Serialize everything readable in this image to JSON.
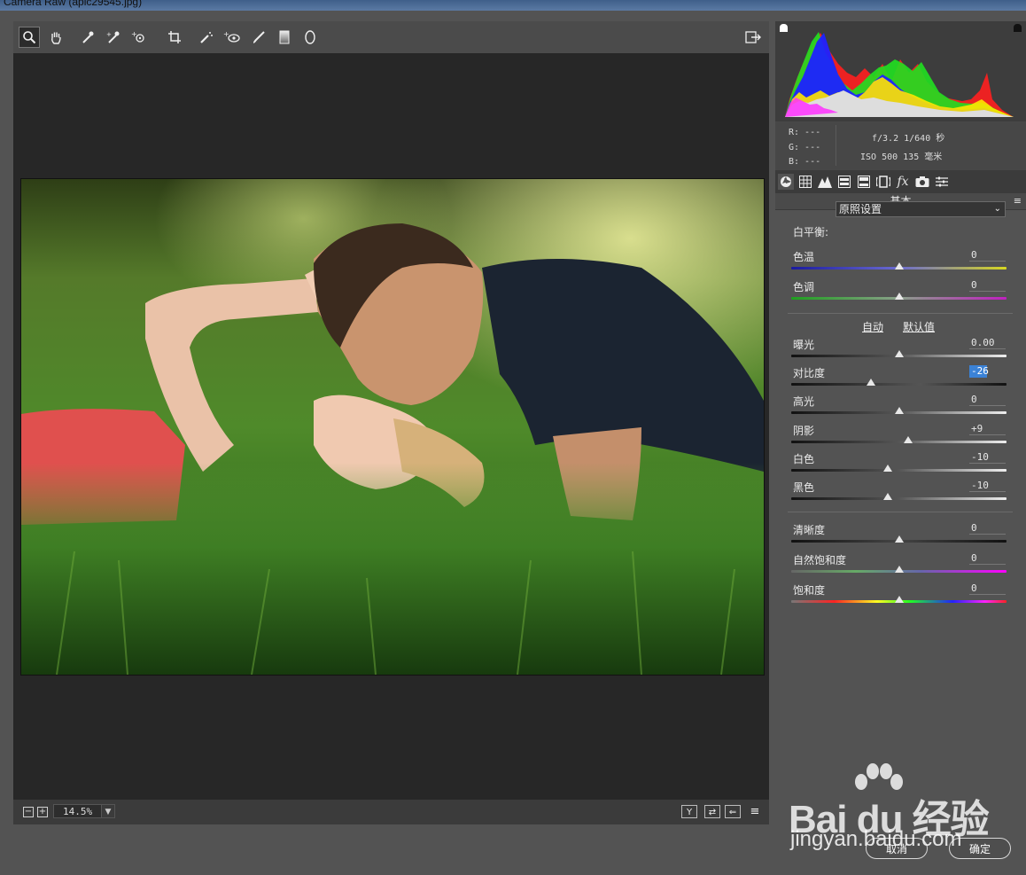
{
  "window": {
    "title": "Camera Raw (apic29545.jpg)"
  },
  "toolbar": {
    "tools": [
      {
        "icon": "zoom-icon",
        "glyph": "🔍",
        "active": true
      },
      {
        "icon": "hand-icon",
        "glyph": "✋"
      },
      {
        "icon": "white-balance-icon",
        "glyph": "✎"
      },
      {
        "icon": "color-sampler-icon",
        "glyph": "✑"
      },
      {
        "icon": "targeted-adjustment-icon",
        "glyph": "⊙"
      },
      {
        "icon": "crop-icon",
        "glyph": "⌗"
      },
      {
        "icon": "spot-removal-icon",
        "glyph": "✐"
      },
      {
        "icon": "red-eye-icon",
        "glyph": "+◎"
      },
      {
        "icon": "adjustment-brush-icon",
        "glyph": "✏"
      },
      {
        "icon": "graduated-filter-icon",
        "glyph": "▮"
      },
      {
        "icon": "radial-filter-icon",
        "glyph": "◯"
      }
    ],
    "preferences_icon": "export-icon"
  },
  "status": {
    "zoom_out": "−",
    "zoom_in": "+",
    "zoom_level": "14.5%",
    "view_buttons": [
      "Y",
      "⇄",
      "⇐",
      "≡"
    ]
  },
  "info": {
    "r": "R:  ---",
    "g": "G:  ---",
    "b": "B:  ---",
    "line1": "f/3.2  1/640 秒",
    "line2": "ISO 500  135 毫米"
  },
  "panel": {
    "title": "基本",
    "white_balance_label": "白平衡:",
    "white_balance_value": "原照设置",
    "auto": "自动",
    "default": "默认值",
    "sliders_wb": [
      {
        "label": "色温",
        "value": "0",
        "level": 0.5
      },
      {
        "label": "色调",
        "value": "0",
        "level": 0.5
      }
    ],
    "sliders_tone": [
      {
        "label": "曝光",
        "value": "0.00",
        "level": 0.5
      },
      {
        "label": "对比度",
        "value": "-26",
        "level": 0.37,
        "selected": true
      },
      {
        "label": "高光",
        "value": "0",
        "level": 0.5
      },
      {
        "label": "阴影",
        "value": "+9",
        "level": 0.545
      },
      {
        "label": "白色",
        "value": "-10",
        "level": 0.45
      },
      {
        "label": "黑色",
        "value": "-10",
        "level": 0.45
      }
    ],
    "sliders_presence": [
      {
        "label": "清晰度",
        "value": "0",
        "level": 0.5
      },
      {
        "label": "自然饱和度",
        "value": "0",
        "level": 0.5
      },
      {
        "label": "饱和度",
        "value": "0",
        "level": 0.5
      }
    ]
  },
  "dialog": {
    "cancel": "取消",
    "ok": "确定"
  },
  "watermark": {
    "brand": "Bai du 经验",
    "url": "jingyan.baidu.com"
  },
  "colors": {
    "accent": "#3b82d6",
    "panel": "#535353",
    "canvas": "#272727"
  }
}
